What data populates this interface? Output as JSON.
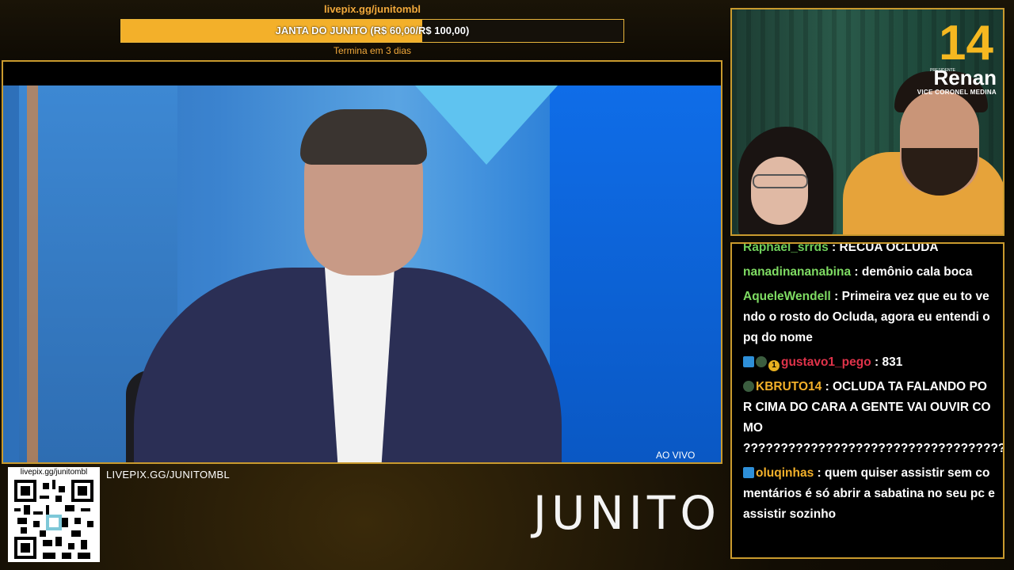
{
  "goal": {
    "url": "livepix.gg/junitombl",
    "label": "JANTA DO JUNITO (R$ 60,00/R$ 100,00)",
    "progress_fraction": 0.6,
    "ends": "Termina em 3 dias"
  },
  "video": {
    "live_label": "AO VIVO"
  },
  "qr": {
    "label": "livepix.gg/junitombl"
  },
  "caption": "LIVEPIX.GG/JUNITOMBL",
  "brand": "JUNITO",
  "webcam": {
    "number": "14",
    "presidente": "PRESIDENTE",
    "name": "Renan",
    "vice": "VICE CORONEL MEDINA"
  },
  "chat": {
    "messages": [
      {
        "user": "Raphael_srrds",
        "user_color": "#6fcf5b",
        "text": "RECUA OCLUDA",
        "badges": []
      },
      {
        "user": "nanadinananabina",
        "user_color": "#7fdc63",
        "text": "demônio cala boca",
        "badges": []
      },
      {
        "user": "AqueleWendell",
        "user_color": "#7fdc63",
        "text": "Primeira vez que eu to vendo o rosto do Ocluda, agora eu entendi o pq do nome",
        "badges": []
      },
      {
        "user": "gustavo1_pego",
        "user_color": "#e0334a",
        "text": "831",
        "badges": [
          "prime-icon",
          "sub-icon",
          "bits-icon"
        ],
        "bits_badge": "1"
      },
      {
        "user": "KBRUTO14",
        "user_color": "#f3b02a",
        "text": "OCLUDA TA FALANDO POR CIMA DO CARA A GENTE VAI OUVIR COMO ????????????????????????????????????????????????????????????????",
        "badges": [
          "sub-icon"
        ]
      },
      {
        "user": "oluqinhas",
        "user_color": "#f3b02a",
        "text": "quem quiser assistir sem comentários é só abrir a sabatina no seu pc e assistir sozinho",
        "badges": [
          "prime-icon"
        ]
      }
    ]
  }
}
